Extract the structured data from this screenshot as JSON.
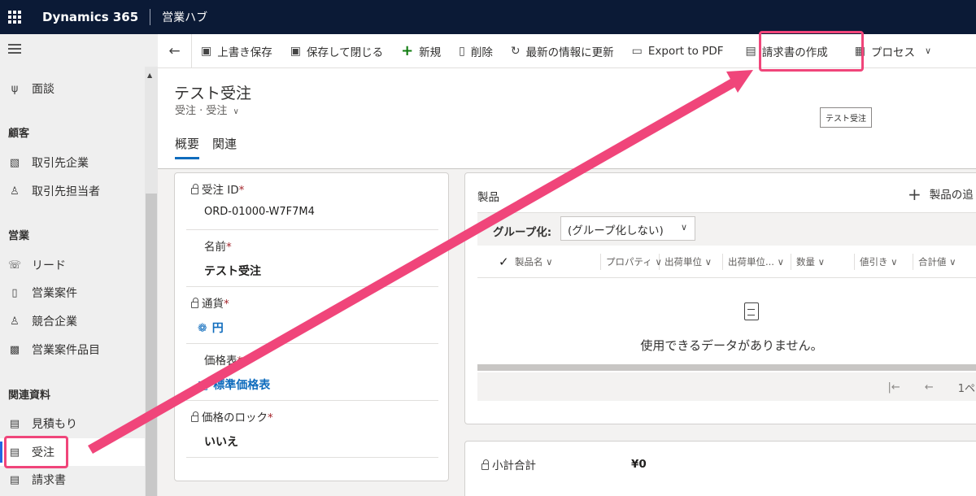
{
  "topbar": {
    "brand": "Dynamics 365",
    "app": "営業ハブ"
  },
  "sidebar": {
    "items": [
      {
        "label": "面談",
        "icon": "meeting-icon"
      },
      {
        "label": "取引先企業",
        "icon": "account-icon"
      },
      {
        "label": "取引先担当者",
        "icon": "contact-icon"
      },
      {
        "label": "リード",
        "icon": "lead-icon"
      },
      {
        "label": "営業案件",
        "icon": "opportunity-icon"
      },
      {
        "label": "競合企業",
        "icon": "competitor-icon"
      },
      {
        "label": "営業案件品目",
        "icon": "opportunity-product-icon"
      },
      {
        "label": "見積もり",
        "icon": "quote-icon"
      },
      {
        "label": "受注",
        "icon": "order-icon"
      },
      {
        "label": "請求書",
        "icon": "invoice-icon"
      }
    ],
    "groups": {
      "customers": "顧客",
      "sales": "営業",
      "collateral": "関連資料"
    }
  },
  "cmdbar": {
    "save": "上書き保存",
    "save_close": "保存して閉じる",
    "new": "新規",
    "delete": "削除",
    "refresh": "最新の情報に更新",
    "export_pdf": "Export to PDF",
    "create_invoice": "請求書の作成",
    "process": "プロセス"
  },
  "header": {
    "title": "テスト受注",
    "subtitle": "受注 · 受注",
    "tooltip": "テスト受注",
    "tabs": [
      "概要",
      "関連"
    ]
  },
  "fields": {
    "order_id": {
      "label": "受注 ID",
      "value": "ORD-01000-W7F7M4"
    },
    "name": {
      "label": "名前",
      "value": "テスト受注"
    },
    "currency": {
      "label": "通貨",
      "value": "円"
    },
    "price_list": {
      "label": "価格表",
      "value": "標準価格表"
    },
    "price_lock": {
      "label": "価格のロック",
      "value": "いいえ"
    }
  },
  "products": {
    "title": "製品",
    "add": "製品の追",
    "group_label": "グループ化:",
    "group_value": "(グループ化しない)",
    "columns": [
      "製品名",
      "プロパティ",
      "出荷単位",
      "出荷単位...",
      "数量",
      "値引き",
      "合計値"
    ],
    "empty": "使用できるデータがありません。",
    "page": "1ペー"
  },
  "totals": {
    "label": "小計合計",
    "value": "¥0"
  },
  "colors": {
    "accent": "#0f6cbd",
    "topbar": "#0b1a36",
    "highlight": "#f0457a"
  }
}
